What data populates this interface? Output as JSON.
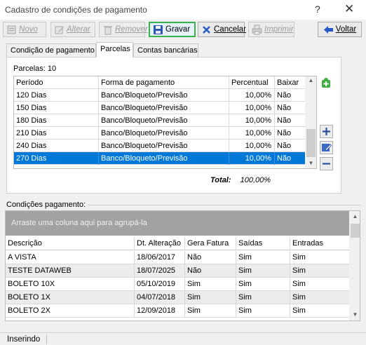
{
  "window": {
    "title": "Cadastro de condições de pagamento",
    "help": "?",
    "close": "✕"
  },
  "toolbar": {
    "novo": "Novo",
    "alterar": "Alterar",
    "remover": "Remover",
    "gravar": "Gravar",
    "cancelar": "Cancelar",
    "imprimir": "Imprimir",
    "voltar": "Voltar"
  },
  "tabs": [
    "Condição de pagamento",
    "Parcelas",
    "Contas bancárias"
  ],
  "parcelas": {
    "count_label": "Parcelas: 10",
    "columns": [
      "Período",
      "Forma de pagamento",
      "Percentual",
      "Baixar"
    ],
    "rows": [
      [
        "120 Dias",
        "Banco/Bloqueto/Previsão",
        "10,00%",
        "Não"
      ],
      [
        "150 Dias",
        "Banco/Bloqueto/Previsão",
        "10,00%",
        "Não"
      ],
      [
        "180 Dias",
        "Banco/Bloqueto/Previsão",
        "10,00%",
        "Não"
      ],
      [
        "210 Dias",
        "Banco/Bloqueto/Previsão",
        "10,00%",
        "Não"
      ],
      [
        "240 Dias",
        "Banco/Bloqueto/Previsão",
        "10,00%",
        "Não"
      ],
      [
        "270 Dias",
        "Banco/Bloqueto/Previsão",
        "10,00%",
        "Não"
      ]
    ],
    "total_label": "Total:",
    "total_value": "100,00%"
  },
  "condicoes": {
    "label": "Condições pagamento:",
    "group_hint": "Arraste uma coluna aqui para agrupá-la",
    "columns": [
      "Descrição",
      "Dt. Alteração",
      "Gera Fatura",
      "Saídas",
      "Entradas"
    ],
    "rows": [
      [
        "A VISTA",
        "18/06/2017",
        "Não",
        "Sim",
        "Sim"
      ],
      [
        "TESTE DATAWEB",
        "18/07/2025",
        "Não",
        "Sim",
        "Sim"
      ],
      [
        "BOLETO 10X",
        "05/10/2019",
        "Sim",
        "Sim",
        "Sim"
      ],
      [
        "BOLETO 1X",
        "04/07/2018",
        "Sim",
        "Sim",
        "Sim"
      ],
      [
        "BOLETO 2X",
        "12/09/2018",
        "Sim",
        "Sim",
        "Sim"
      ]
    ]
  },
  "status": {
    "mode": "Inserindo"
  },
  "colors": {
    "selection": "#0078d7",
    "highlight_border": "#37b24d",
    "group_bar": "#a2a2a2"
  }
}
